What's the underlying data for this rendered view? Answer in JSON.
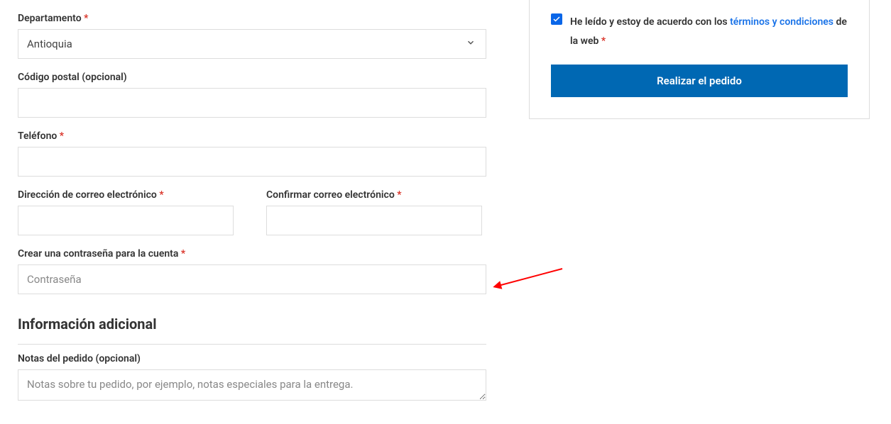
{
  "billing": {
    "departamento_label": "Departamento",
    "departamento_value": "Antioquia",
    "postal_label": "Código postal (opcional)",
    "telefono_label": "Teléfono",
    "email_label": "Dirección de correo electrónico",
    "email_confirm_label": "Confirmar correo electrónico",
    "password_label": "Crear una contraseña para la cuenta",
    "password_placeholder": "Contraseña"
  },
  "additional": {
    "heading": "Información adicional",
    "notes_label": "Notas del pedido (opcional)",
    "notes_placeholder": "Notas sobre tu pedido, por ejemplo, notas especiales para la entrega."
  },
  "sidebar": {
    "terms_prefix": "He leído y estoy de acuerdo con los ",
    "terms_link": "términos y condiciones",
    "terms_suffix": " de la web",
    "terms_checked": true,
    "place_order_label": "Realizar el pedido"
  },
  "required_star": "*"
}
